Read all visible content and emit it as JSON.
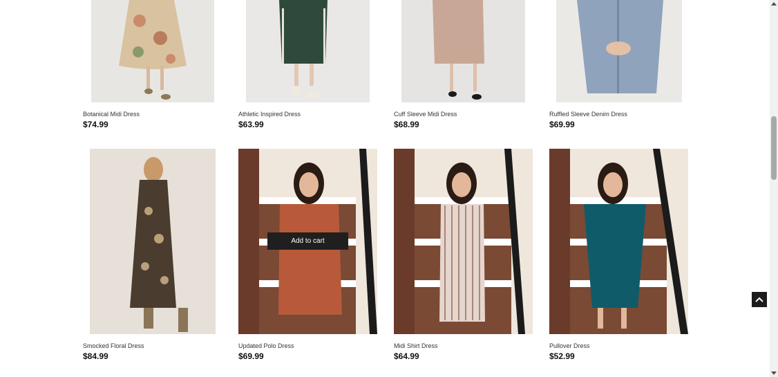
{
  "products": [
    {
      "title": "Botanical Midi Dress",
      "price": "$74.99"
    },
    {
      "title": "Athletic Inspired Dress",
      "price": "$63.99"
    },
    {
      "title": "Cuff Sleeve Midi Dress",
      "price": "$68.99"
    },
    {
      "title": "Ruffled Sleeve Denim Dress",
      "price": "$69.99"
    },
    {
      "title": "Smocked Floral Dress",
      "price": "$84.99"
    },
    {
      "title": "Updated Polo Dress",
      "price": "$69.99"
    },
    {
      "title": "Midi Shirt Dress",
      "price": "$64.99"
    },
    {
      "title": "Pullover Dress",
      "price": "$52.99"
    }
  ],
  "quick_add": {
    "label": "Add to cart"
  },
  "icons": {
    "back_to_top": "chevron-up-icon"
  },
  "colors": {
    "button_bg": "#1f1f1f",
    "button_text": "#ffffff"
  }
}
